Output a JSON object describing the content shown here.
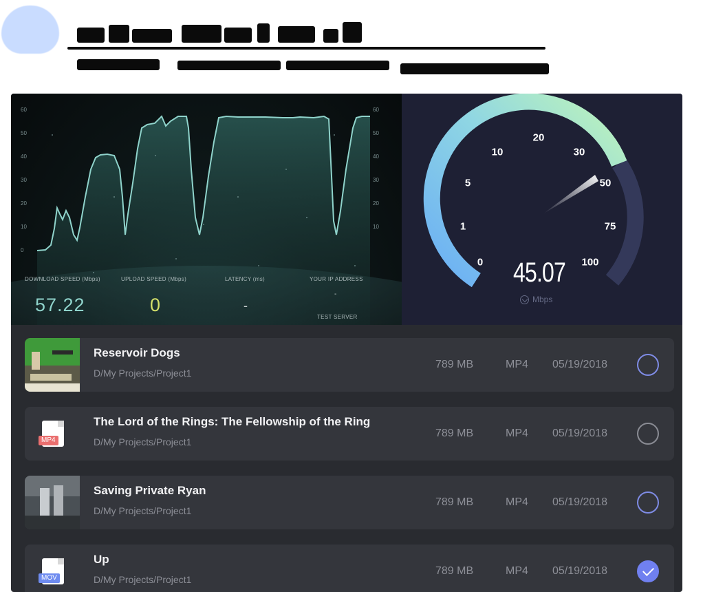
{
  "chart": {
    "left_axis_ticks": [
      "0",
      "10",
      "20",
      "30",
      "40",
      "50",
      "60"
    ],
    "right_axis_ticks": [
      "10",
      "20",
      "30",
      "40",
      "50",
      "60"
    ],
    "metrics": {
      "download_label": "DOWNLOAD SPEED (Mbps)",
      "upload_label": "UPLOAD SPEED (Mbps)",
      "latency_label": "LATENCY (ms)",
      "ip_label": "YOUR IP ADDRESS",
      "download_value": "57.22",
      "upload_value": "0",
      "latency_value": "-",
      "ip_value": "-",
      "test_server_label": "TEST SERVER"
    },
    "colors": {
      "line": "#8fd3cb",
      "download": "#8fd3cb",
      "upload": "#d4e06a"
    }
  },
  "gauge": {
    "scale_labels": [
      "0",
      "1",
      "5",
      "10",
      "20",
      "30",
      "50",
      "75",
      "100"
    ],
    "value": "45.07",
    "unit": "Mbps",
    "icon": "download-circle-icon",
    "colors": {
      "arc_start": "#7ab8f5",
      "arc_end": "#b7f0c0",
      "track": "#34395a"
    }
  },
  "files": [
    {
      "title": "Reservoir Dogs",
      "path": "D/My Projects/Project1",
      "size": "789 MB",
      "type": "MP4",
      "date": "05/19/2018",
      "thumb": "image",
      "checked": false
    },
    {
      "title": "The Lord of the Rings: The Fellowship of the Ring",
      "path": "D/My Projects/Project1",
      "size": "789 MB",
      "type": "MP4",
      "date": "05/19/2018",
      "thumb": "doc",
      "badge": "MP4",
      "badge_color": "#ea6f6f",
      "checked": false
    },
    {
      "title": "Saving Private Ryan",
      "path": "D/My Projects/Project1",
      "size": "789 MB",
      "type": "MP4",
      "date": "05/19/2018",
      "thumb": "image",
      "checked": false
    },
    {
      "title": "Up",
      "path": "D/My Projects/Project1",
      "size": "789 MB",
      "type": "MP4",
      "date": "05/19/2018",
      "thumb": "doc",
      "badge": "MOV",
      "badge_color": "#6f8cf0",
      "checked": true
    }
  ]
}
